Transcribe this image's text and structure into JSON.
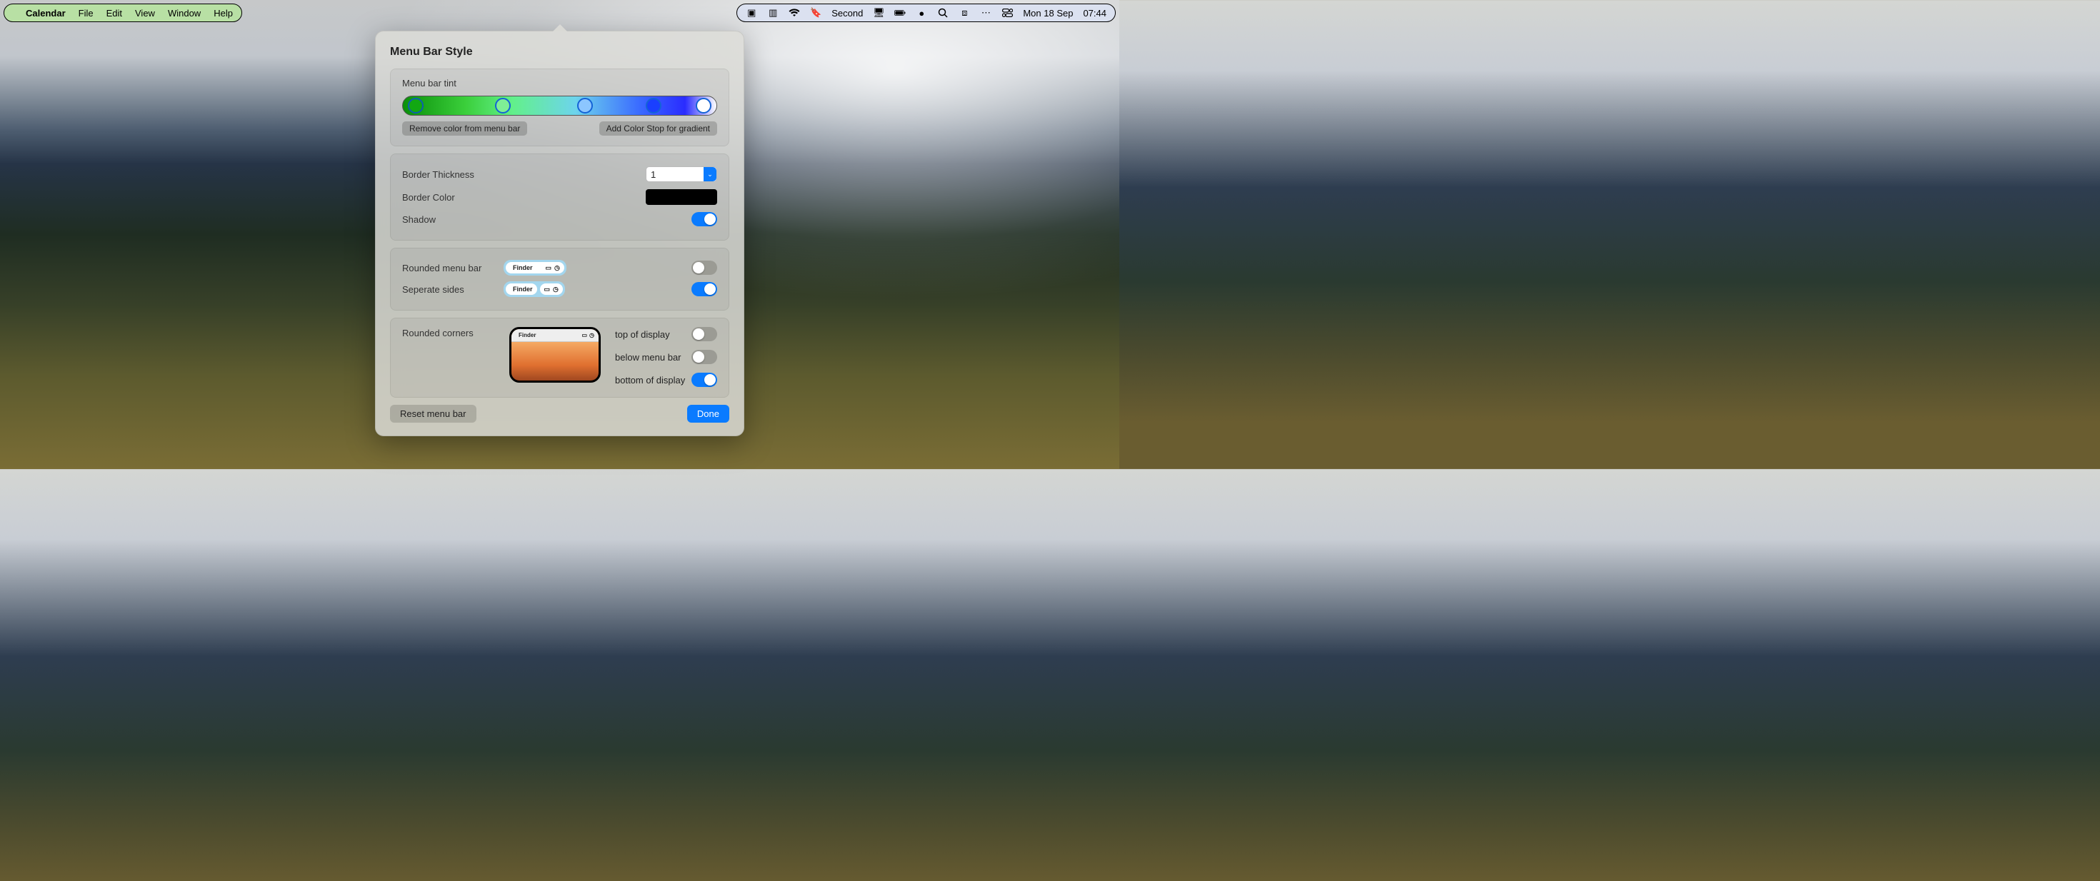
{
  "menubar_left": {
    "app": "Calendar",
    "items": [
      "File",
      "Edit",
      "View",
      "Window",
      "Help"
    ]
  },
  "menubar_right": {
    "bookmark_label": "Second",
    "date": "Mon 18 Sep",
    "time": "07:44"
  },
  "popover": {
    "title": "Menu Bar Style",
    "tint": {
      "heading": "Menu bar tint",
      "remove_btn": "Remove color from menu bar",
      "add_btn": "Add Color Stop for gradient"
    },
    "border": {
      "thickness_label": "Border Thickness",
      "thickness_value": "1",
      "color_label": "Border Color",
      "shadow_label": "Shadow",
      "shadow_on": true
    },
    "rounded": {
      "rounded_label": "Rounded menu bar",
      "rounded_on": false,
      "separate_label": "Seperate sides",
      "separate_on": true,
      "preview_app": "Finder"
    },
    "corners": {
      "heading": "Rounded corners",
      "preview_app": "Finder",
      "top_label": "top of display",
      "top_on": false,
      "below_label": "below menu bar",
      "below_on": false,
      "bottom_label": "bottom of display",
      "bottom_on": true
    },
    "footer": {
      "reset": "Reset menu bar",
      "done": "Done"
    }
  }
}
